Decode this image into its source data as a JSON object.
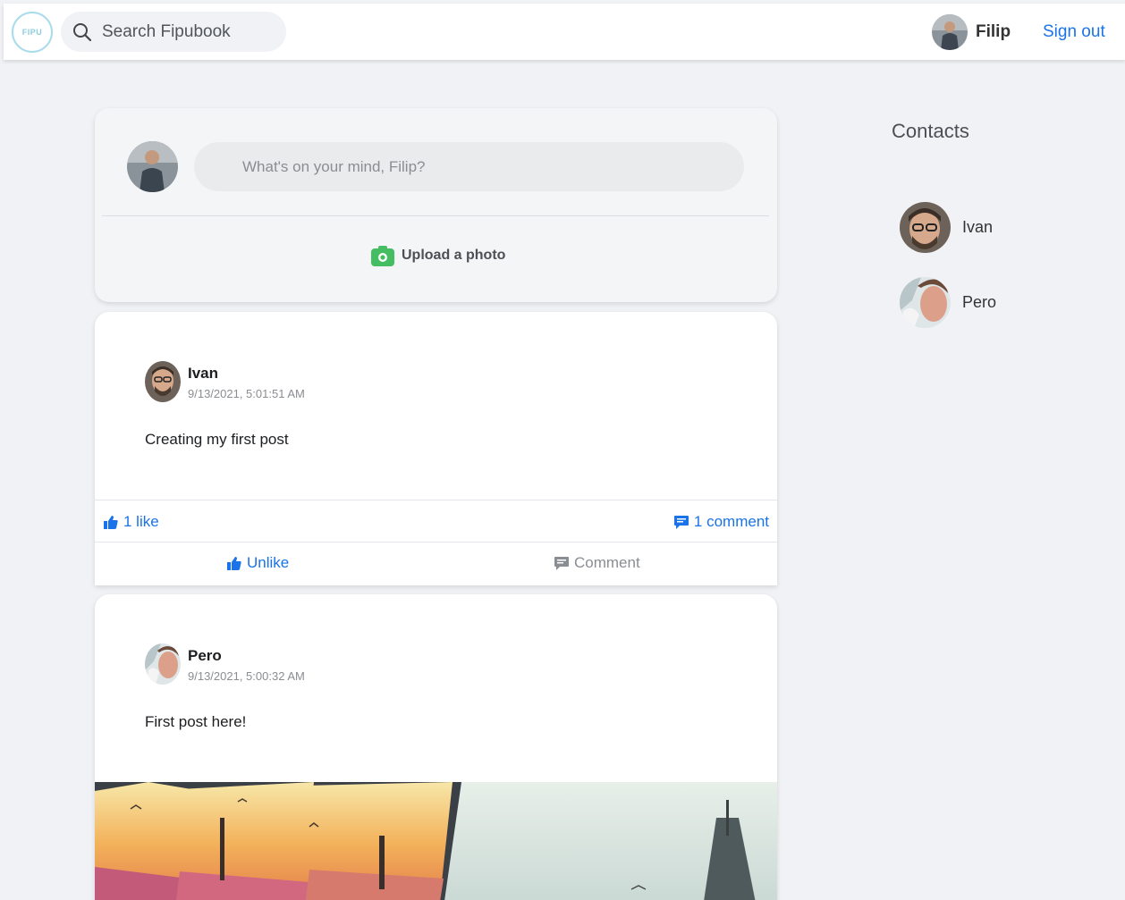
{
  "navbar": {
    "logo_text": "FIPU",
    "search_placeholder": "Search Fipubook",
    "user_name": "Filip",
    "signout_label": "Sign out"
  },
  "composer": {
    "placeholder": "What's on your mind, Filip?",
    "upload_label": "Upload a photo"
  },
  "posts": [
    {
      "author": "Ivan",
      "time": "9/13/2021, 5:01:51 AM",
      "text": "Creating my first post",
      "likes_label": "1 like",
      "comments_label": "1 comment",
      "unlike_label": "Unlike",
      "comment_label": "Comment"
    },
    {
      "author": "Pero",
      "time": "9/13/2021, 5:00:32 AM",
      "text": "First post here!"
    }
  ],
  "contacts": {
    "title": "Contacts",
    "items": [
      {
        "name": "Ivan"
      },
      {
        "name": "Pero"
      }
    ]
  },
  "colors": {
    "accent": "#1a73e8",
    "background": "#f0f2f5",
    "upload_icon": "#45bd62"
  }
}
